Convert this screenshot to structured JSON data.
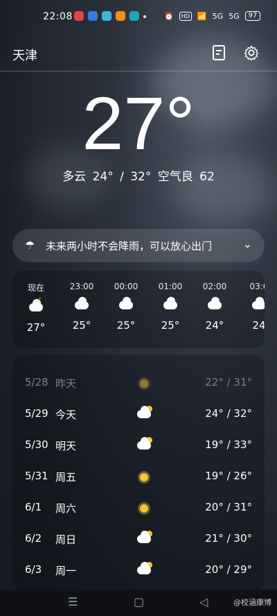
{
  "status_bar": {
    "time": "22:08",
    "apps": [
      "app-red",
      "app-blue",
      "app-cyan",
      "app-orange",
      "app-teal"
    ],
    "hd": "HD",
    "signal1": "5G",
    "signal2": "5G",
    "battery": "97"
  },
  "header": {
    "city": "天津",
    "icons": [
      "document-icon",
      "gear-icon"
    ]
  },
  "current": {
    "temp": "27°",
    "summary": "多云  24° / 32°  空气良 62"
  },
  "rain": {
    "text": "未来两小时不会降雨，可以放心出门",
    "icon": "umbrella-icon"
  },
  "hourly": [
    {
      "time": "现在",
      "icon": "cloudy-night-icon",
      "temp": "27°"
    },
    {
      "time": "23:00",
      "icon": "cloud-icon",
      "temp": "25°"
    },
    {
      "time": "00:00",
      "icon": "cloud-icon",
      "temp": "25°"
    },
    {
      "time": "01:00",
      "icon": "cloud-icon",
      "temp": "25°"
    },
    {
      "time": "02:00",
      "icon": "cloud-icon",
      "temp": "24°"
    },
    {
      "time": "03:0",
      "icon": "cloud-icon",
      "temp": "24"
    }
  ],
  "daily": [
    {
      "date": "5/28",
      "name": "昨天",
      "icon": "sun-icon",
      "temp": "22° / 31°"
    },
    {
      "date": "5/29",
      "name": "今天",
      "icon": "partly-cloudy-icon",
      "temp": "24° / 32°"
    },
    {
      "date": "5/30",
      "name": "明天",
      "icon": "partly-cloudy-icon",
      "temp": "19° / 33°"
    },
    {
      "date": "5/31",
      "name": "周五",
      "icon": "sun-icon",
      "temp": "19° / 26°"
    },
    {
      "date": "6/1",
      "name": "周六",
      "icon": "sun-icon",
      "temp": "20° / 31°"
    },
    {
      "date": "6/2",
      "name": "周日",
      "icon": "partly-cloudy-icon",
      "temp": "21° / 30°"
    },
    {
      "date": "6/3",
      "name": "周一",
      "icon": "partly-cloudy-icon",
      "temp": "20° / 29°"
    }
  ],
  "navbar": {
    "watermark": "@校涵康博"
  },
  "colors": {
    "sun": "#f5c542",
    "background": "#1c2029"
  }
}
